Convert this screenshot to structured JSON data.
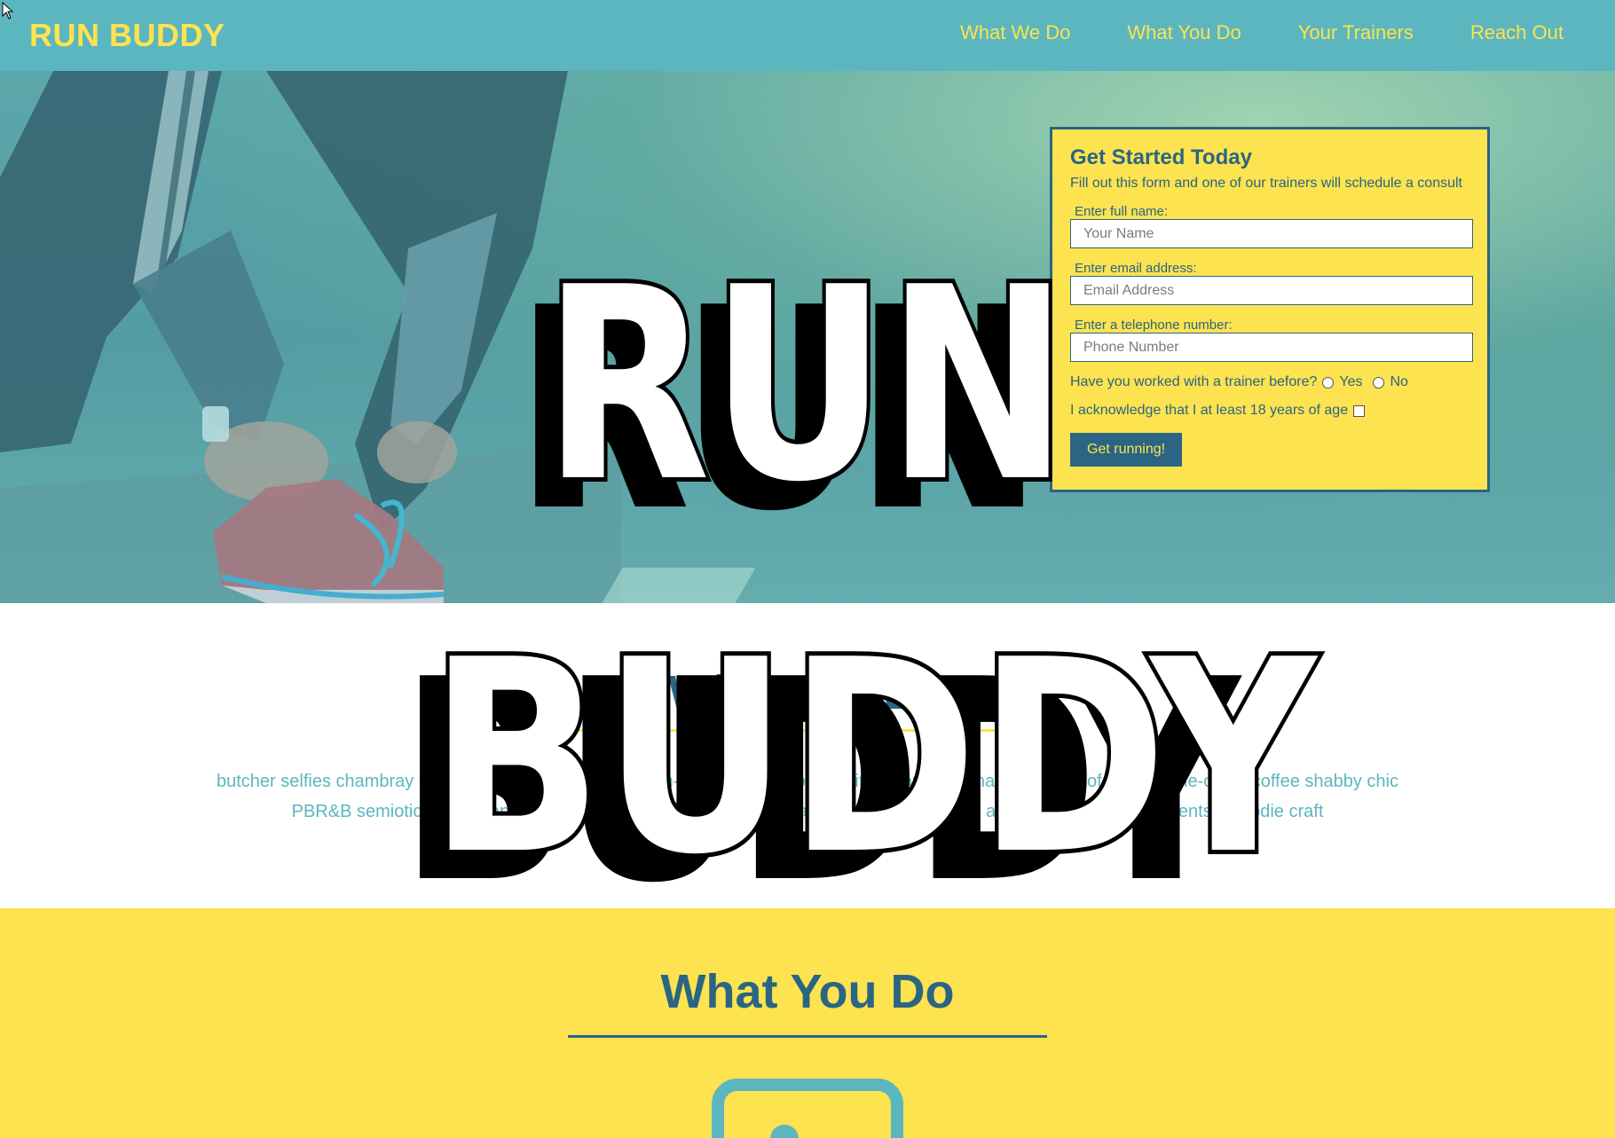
{
  "header": {
    "brand": "RUN BUDDY",
    "nav": [
      "What We Do",
      "What You Do",
      "Your Trainers",
      "Reach Out"
    ]
  },
  "form": {
    "title": "Get Started Today",
    "subtitle": "Fill out this form and one of our trainers will schedule a consult",
    "name_label": "Enter full name:",
    "name_placeholder": "Your Name",
    "email_label": "Enter email address:",
    "email_placeholder": "Email Address",
    "phone_label": "Enter a telephone number:",
    "phone_placeholder": "Phone Number",
    "trainer_question": "Have you worked with a trainer before?",
    "yes_label": "Yes",
    "no_label": "No",
    "age_ack": "I acknowledge that I at least 18 years of age",
    "submit_label": "Get running!"
  },
  "big_logo": {
    "line1": "RUN",
    "line2": "BUDDY"
  },
  "what_we_do": {
    "heading": "What We Do",
    "text": "butcher selfies chambray ugh, literally paleo quinoa gluten-free wolf put a bird on it you probably haven't heard of them single-origin coffee shabby chic PBR&B semiotics American Apparel whatever craft undercats viral bitters singular street art meh chillwave intelligentsia hoodie craft"
  },
  "what_you_do": {
    "heading": "What You Do"
  },
  "colors": {
    "teal": "#5cb6bf",
    "yellow": "#fce34f",
    "navy": "#2b6584"
  },
  "icons": [
    "cursor-arrow-icon",
    "trainer-card-icon"
  ]
}
